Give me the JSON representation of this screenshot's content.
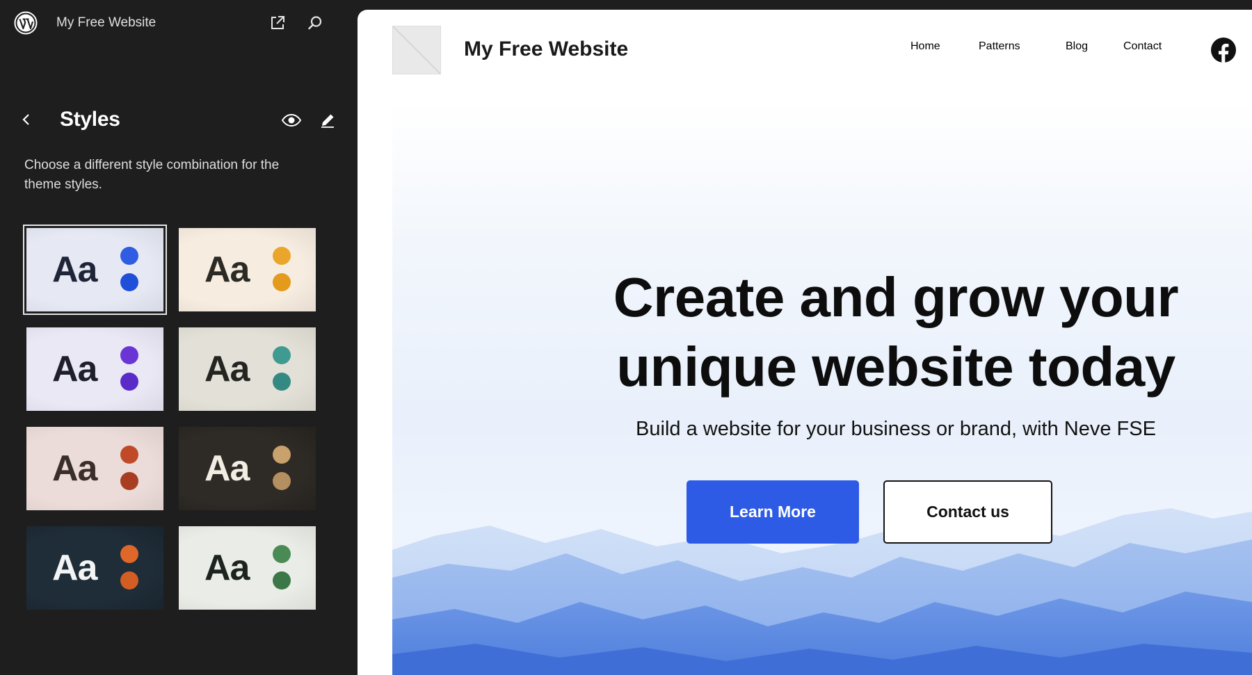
{
  "sidebar": {
    "site_name": "My Free Website",
    "panel_title": "Styles",
    "description": "Choose a different style combination for the theme styles.",
    "variations": [
      {
        "label": "Aa",
        "bg": "#e6e9f4",
        "text": "#1f2538",
        "dot1": "#2f5ce3",
        "dot2": "#1f4fd8",
        "selected": true
      },
      {
        "label": "Aa",
        "bg": "#f6ece0",
        "text": "#2b2a25",
        "dot1": "#eaa62a",
        "dot2": "#e39a1d",
        "selected": false
      },
      {
        "label": "Aa",
        "bg": "#ebe8f6",
        "text": "#1f1f2c",
        "dot1": "#6b35d6",
        "dot2": "#5a2bc8",
        "selected": false
      },
      {
        "label": "Aa",
        "bg": "#e3e1d7",
        "text": "#242521",
        "dot1": "#3f9b92",
        "dot2": "#348a82",
        "selected": false
      },
      {
        "label": "Aa",
        "bg": "#ecdcd9",
        "text": "#3a2e2b",
        "dot1": "#c04a28",
        "dot2": "#a83e21",
        "selected": false
      },
      {
        "label": "Aa",
        "bg": "#2e2a25",
        "text": "#f2ede2",
        "dot1": "#c8a16d",
        "dot2": "#b48f60",
        "selected": false
      },
      {
        "label": "Aa",
        "bg": "#1f2d38",
        "text": "#f3f4f4",
        "dot1": "#e0672a",
        "dot2": "#d35e24",
        "selected": false
      },
      {
        "label": "Aa",
        "bg": "#eaede7",
        "text": "#1d231f",
        "dot1": "#4a8a55",
        "dot2": "#3c7747",
        "selected": false
      }
    ]
  },
  "preview": {
    "brand": "My Free Website",
    "nav": [
      "Home",
      "Patterns",
      "Blog",
      "Contact"
    ],
    "hero_title_line1": "Create and grow your",
    "hero_title_line2": "unique website today",
    "hero_subtitle": "Build a website for your business or brand, with Neve FSE",
    "primary_button": "Learn More",
    "secondary_button": "Contact us",
    "accent_color": "#2e5be6"
  },
  "icons": {
    "wordpress": "wordpress-logo-icon",
    "view_site": "external-link-icon",
    "search": "search-icon",
    "back": "chevron-left-icon",
    "preview": "eye-icon",
    "edit": "pencil-icon",
    "social": "facebook-icon"
  }
}
